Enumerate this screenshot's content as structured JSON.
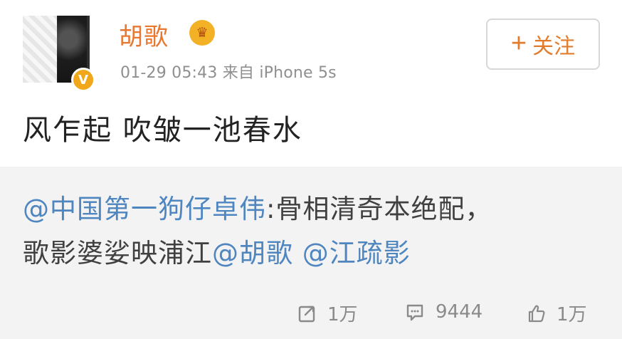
{
  "post": {
    "username": "胡歌",
    "time": "01-29 05:43",
    "source": "来自 iPhone 5s",
    "follow_label": "关注",
    "content": "风乍起 吹皱一池春水"
  },
  "repost": {
    "author_mention": "@中国第一狗仔卓伟",
    "line1_text": ":骨相清奇本绝配，",
    "line2_text": "歌影婆娑映浦江",
    "mention_hu_ge": "@胡歌",
    "mention_jiang_shuying": "@江疏影"
  },
  "actions": {
    "repost_count": "1万",
    "comment_count": "9444",
    "like_count": "1万"
  },
  "colors": {
    "username": "#e9772f",
    "mention": "#4f86bf",
    "repost_background": "#f3f3f3",
    "follow": "#e27c2d"
  },
  "icons": {
    "avatar": "avatar",
    "verified": "verified-badge-icon",
    "crown": "crown-icon",
    "follow": "plus-icon",
    "repost": "repost-icon",
    "comment": "comment-icon",
    "like": "thumbs-up-icon"
  }
}
